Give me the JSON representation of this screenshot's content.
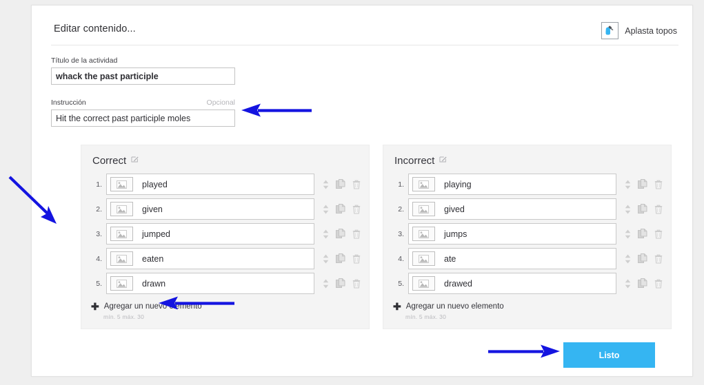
{
  "header": {
    "title": "Editar contenido...",
    "brand_label": "Aplasta topos",
    "brand_icon": "mole-hammer-icon"
  },
  "form": {
    "title_field": {
      "label": "Título de la actividad",
      "value": "whack the past participle",
      "placeholder": ""
    },
    "instruction_field": {
      "label": "Instrucción",
      "optional_label": "Opcional",
      "value": "Hit the correct past participle moles",
      "placeholder": ""
    }
  },
  "panels": [
    {
      "title": "Correct",
      "edit_icon": "edit-pencil-icon",
      "items": [
        {
          "index": "1.",
          "text": "played",
          "thumb_icon": "image-placeholder-icon"
        },
        {
          "index": "2.",
          "text": "given",
          "thumb_icon": "image-placeholder-icon"
        },
        {
          "index": "3.",
          "text": "jumped",
          "thumb_icon": "image-placeholder-icon"
        },
        {
          "index": "4.",
          "text": "eaten",
          "thumb_icon": "image-placeholder-icon"
        },
        {
          "index": "5.",
          "text": "drawn",
          "thumb_icon": "image-placeholder-icon"
        }
      ],
      "add_label": "Agregar un nuevo elemento",
      "minmax": "mín. 5   máx. 30"
    },
    {
      "title": "Incorrect",
      "edit_icon": "edit-pencil-icon",
      "items": [
        {
          "index": "1.",
          "text": "playing",
          "thumb_icon": "image-placeholder-icon"
        },
        {
          "index": "2.",
          "text": "gived",
          "thumb_icon": "image-placeholder-icon"
        },
        {
          "index": "3.",
          "text": "jumps",
          "thumb_icon": "image-placeholder-icon"
        },
        {
          "index": "4.",
          "text": "ate",
          "thumb_icon": "image-placeholder-icon"
        },
        {
          "index": "5.",
          "text": "drawed",
          "thumb_icon": "image-placeholder-icon"
        }
      ],
      "add_label": "Agregar un nuevo elemento",
      "minmax": "mín. 5   máx. 30"
    }
  ],
  "row_action_icons": {
    "reorder": "sort-updown-icon",
    "duplicate": "copy-icon",
    "delete": "trash-icon"
  },
  "footer": {
    "done_label": "Listo"
  },
  "annotations": {
    "color": "#1414e0",
    "arrows": [
      {
        "name": "arrow-to-instruction-field",
        "direction": "left"
      },
      {
        "name": "arrow-to-correct-panel",
        "direction": "down-right"
      },
      {
        "name": "arrow-to-add-new-item",
        "direction": "left"
      },
      {
        "name": "arrow-to-done-button",
        "direction": "right"
      }
    ]
  },
  "colors": {
    "page_background": "#efefef",
    "card_background": "#ffffff",
    "panel_background": "#f4f4f4",
    "accent_button": "#35b5f2",
    "annotation_blue": "#1414e0"
  }
}
